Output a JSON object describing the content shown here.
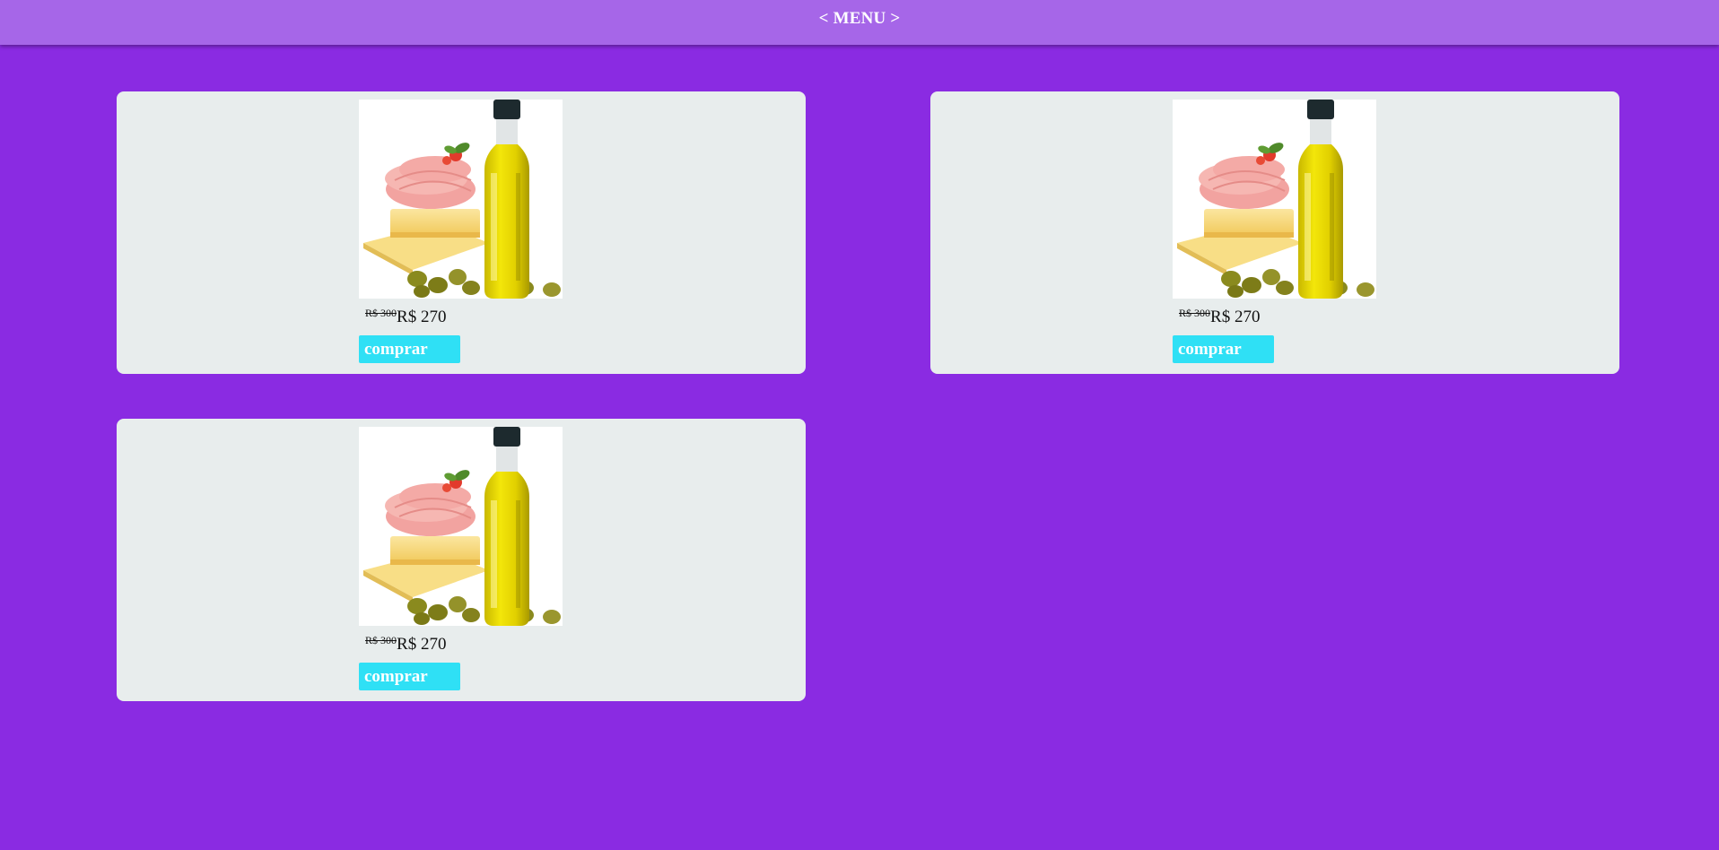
{
  "header": {
    "title": "< MENU >"
  },
  "products": [
    {
      "image_icon": "olive-oil-ham-cheese-photo",
      "old_price": "R$ 300",
      "price": "R$ 270",
      "buy_label": "comprar"
    },
    {
      "image_icon": "olive-oil-ham-cheese-photo",
      "old_price": "R$ 300",
      "price": "R$ 270",
      "buy_label": "comprar"
    },
    {
      "image_icon": "olive-oil-ham-cheese-photo",
      "old_price": "R$ 300",
      "price": "R$ 270",
      "buy_label": "comprar"
    }
  ],
  "colors": {
    "background": "#8a2be2",
    "header": "#a666e8",
    "card": "#e8eded",
    "button": "#2fe0f5"
  }
}
